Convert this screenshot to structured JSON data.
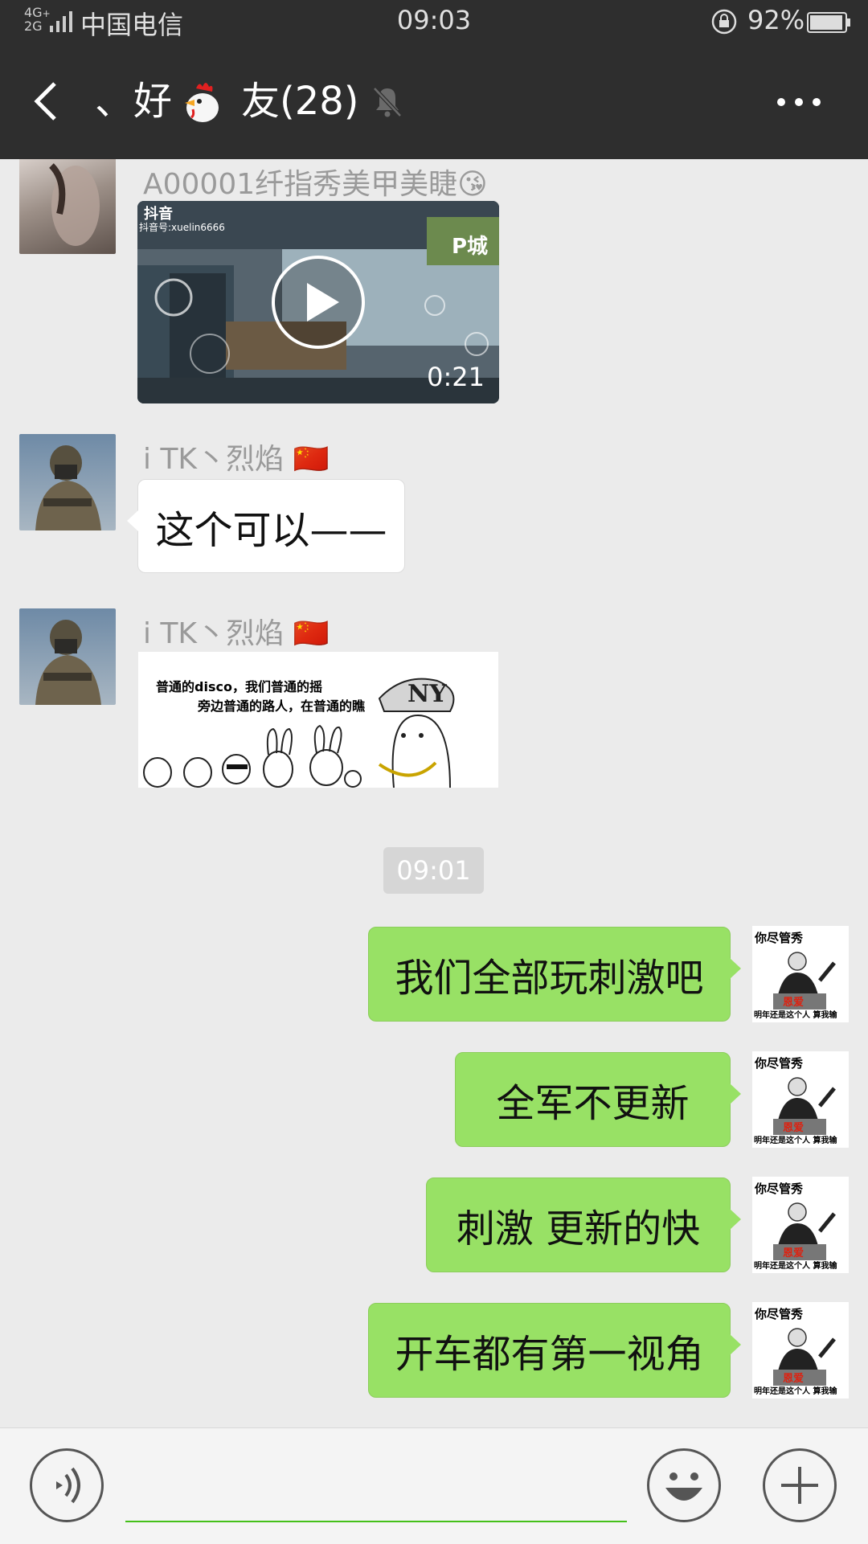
{
  "status_bar": {
    "network": "4G+\n2G",
    "carrier": "中国电信",
    "time": "09:03",
    "battery": "92%"
  },
  "header": {
    "title_prefix": "、好",
    "title_emoji": "chicken",
    "title_suffix": "友(28)",
    "muted": true
  },
  "messages": [
    {
      "sender": "A00001纤指秀美甲美睫😘",
      "type": "video",
      "overlay_app": "抖音",
      "overlay_id": "抖音号:xuelin6666",
      "overlay_place": "P城",
      "duration": "0:21"
    },
    {
      "sender": "i  TK丶烈焰 🇨🇳",
      "type": "text",
      "text": "这个可以——"
    },
    {
      "sender": "i  TK丶烈焰 🇨🇳",
      "type": "sticker",
      "line1": "普通的disco，我们普通的摇",
      "line2": "旁边普通的路人，在普通的瞧"
    }
  ],
  "timestamp": "09:01",
  "outgoing": [
    {
      "text": "我们全部玩刺激吧"
    },
    {
      "text": "全军不更新"
    },
    {
      "text": "刺激 更新的快"
    },
    {
      "text": "开车都有第一视角"
    }
  ],
  "my_avatar": {
    "top_text": "你尽管秀",
    "middle_text": "恩爱",
    "bottom_text": "明年还是这个人 算我输"
  },
  "input_bar": {
    "voice_icon": "voice-icon",
    "emoji_icon": "emoji-icon",
    "plus_icon": "plus-icon"
  }
}
